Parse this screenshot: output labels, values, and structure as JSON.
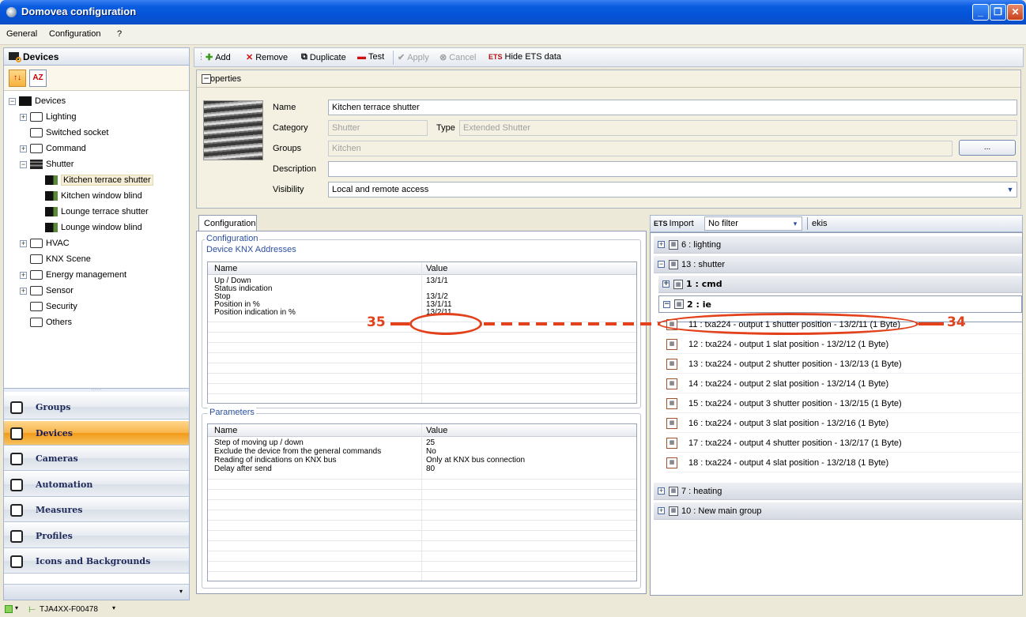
{
  "window": {
    "title": "Domovea configuration"
  },
  "menu": {
    "items": [
      "General",
      "Configuration",
      "?"
    ]
  },
  "left_panel": {
    "header": "Devices",
    "tree": [
      {
        "label": "Devices",
        "level": 0,
        "expander": "−"
      },
      {
        "label": "Lighting",
        "level": 1,
        "expander": "+"
      },
      {
        "label": "Switched socket",
        "level": 1,
        "expander": ""
      },
      {
        "label": "Command",
        "level": 1,
        "expander": "+"
      },
      {
        "label": "Shutter",
        "level": 1,
        "expander": "−"
      },
      {
        "label": "Kitchen terrace shutter",
        "level": 2,
        "expander": "",
        "selected": true
      },
      {
        "label": "Kitchen window blind",
        "level": 2,
        "expander": ""
      },
      {
        "label": "Lounge terrace shutter",
        "level": 2,
        "expander": ""
      },
      {
        "label": "Lounge window blind",
        "level": 2,
        "expander": ""
      },
      {
        "label": "HVAC",
        "level": 1,
        "expander": "+"
      },
      {
        "label": "KNX Scene",
        "level": 1,
        "expander": ""
      },
      {
        "label": "Energy management",
        "level": 1,
        "expander": "+"
      },
      {
        "label": "Sensor",
        "level": 1,
        "expander": "+"
      },
      {
        "label": "Security",
        "level": 1,
        "expander": ""
      },
      {
        "label": "Others",
        "level": 1,
        "expander": ""
      }
    ],
    "nav": [
      {
        "label": "Groups",
        "active": false,
        "icon": "groups-icon"
      },
      {
        "label": "Devices",
        "active": true,
        "icon": "devices-icon"
      },
      {
        "label": "Cameras",
        "active": false,
        "icon": "camera-icon"
      },
      {
        "label": "Automation",
        "active": false,
        "icon": "automation-icon"
      },
      {
        "label": "Measures",
        "active": false,
        "icon": "measures-icon"
      },
      {
        "label": "Profiles",
        "active": false,
        "icon": "profiles-icon"
      },
      {
        "label": "Icons and Backgrounds",
        "active": false,
        "icon": "icons-backgrounds-icon"
      }
    ]
  },
  "toolbar": {
    "add": "Add",
    "remove": "Remove",
    "duplicate": "Duplicate",
    "test": "Test",
    "apply": "Apply",
    "cancel": "Cancel",
    "hide_ets": "Hide ETS data"
  },
  "properties": {
    "header": "Properties",
    "name_label": "Name",
    "name_value": "Kitchen terrace shutter",
    "category_label": "Category",
    "category_value": "Shutter",
    "type_label": "Type",
    "type_value": "Extended Shutter",
    "groups_label": "Groups",
    "groups_value": "Kitchen",
    "browse_label": "...",
    "description_label": "Description",
    "description_value": "",
    "visibility_label": "Visibility",
    "visibility_value": "Local and remote access"
  },
  "configuration": {
    "tab": "Configuration",
    "group_title": "Configuration",
    "knx_title": "Device KNX Addresses",
    "knx_columns": [
      "Name",
      "Value"
    ],
    "knx_rows": [
      [
        "Up / Down",
        "13/1/1"
      ],
      [
        "Status indication",
        ""
      ],
      [
        "Stop",
        "13/1/2"
      ],
      [
        "Position in %",
        "13/1/11"
      ],
      [
        "Position indication in %",
        "13/2/11"
      ]
    ],
    "params_title": "Parameters",
    "params_columns": [
      "Name",
      "Value"
    ],
    "params_rows": [
      [
        "Step of moving up / down",
        "25"
      ],
      [
        "Exclude the device from the general commands",
        "No"
      ],
      [
        "Reading of indications on KNX bus",
        "Only at KNX bus connection"
      ],
      [
        "Delay after send",
        "80"
      ]
    ]
  },
  "ets": {
    "import_label": "Import",
    "filter_value": "No filter",
    "search_value": "ekis",
    "groups": [
      {
        "label": "6 : lighting",
        "expander": "+"
      },
      {
        "label": "13 : shutter",
        "expander": "−"
      },
      {
        "label": "1 : cmd",
        "expander": "+"
      },
      {
        "label": "2 : ie",
        "expander": "−"
      },
      {
        "label": "7 : heating",
        "expander": "+"
      },
      {
        "label": "10 : New main group",
        "expander": "+"
      }
    ],
    "objects": [
      "11 : txa224 - output 1 shutter position - 13/2/11 (1 Byte)",
      "12 : txa224 - output 1 slat position - 13/2/12 (1 Byte)",
      "13 : txa224 - output 2 shutter position - 13/2/13 (1 Byte)",
      "14 : txa224 - output 2 slat position - 13/2/14 (1 Byte)",
      "15 : txa224 - output 3 shutter position - 13/2/15 (1 Byte)",
      "16 : txa224 - output 3 slat position - 13/2/16 (1 Byte)",
      "17 : txa224 - output 4 shutter position - 13/2/17 (1 Byte)",
      "18 : txa224 - output 4 slat position - 13/2/18 (1 Byte)"
    ]
  },
  "annotations": {
    "left": "35",
    "right": "34",
    "color": "#e2411b"
  },
  "statusbar": {
    "text": "TJA4XX-F00478"
  }
}
